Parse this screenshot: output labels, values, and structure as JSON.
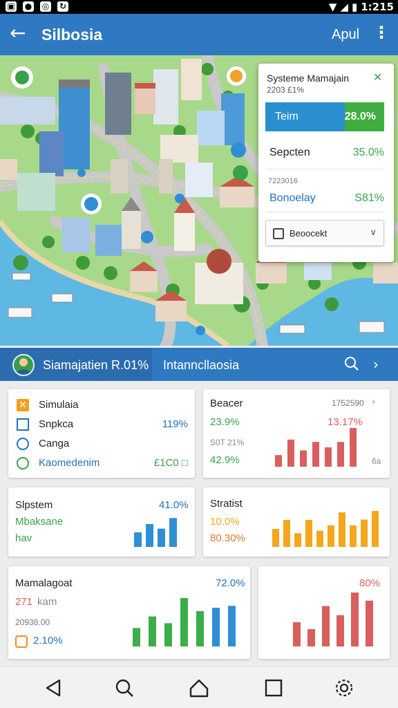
{
  "status_bar": {
    "time": "1:215"
  },
  "app_bar": {
    "title": "Silbosia",
    "right_label": "Apul"
  },
  "panel": {
    "title": "Systeme Mamajain",
    "subtitle": "2203 £1%",
    "progress": {
      "label": "Teim",
      "value": "28.0%",
      "fill_fraction": 0.33
    },
    "row1": {
      "label": "Sepcten",
      "value": "35.0%"
    },
    "row2": {
      "sublabel": "7223016",
      "label": "Bonoelay",
      "value": "S81%"
    },
    "dropdown": {
      "value": "Beoocekt"
    }
  },
  "sim_bar": {
    "title": "Siamajatien R.01%",
    "subtitle": "Intanncllaosia"
  },
  "card_legend": {
    "items": [
      {
        "label": "Simulaia",
        "value": "",
        "icon": "orange-x-icon",
        "color": "#f0a020"
      },
      {
        "label": "Snpkca",
        "value": "119%",
        "icon": "square-icon",
        "color": "#1e72b8"
      },
      {
        "label": "Canga",
        "value": "",
        "icon": "gauge-icon",
        "color": "#1e72b8"
      },
      {
        "label": "Kaomedenim",
        "value": "£1C0 □",
        "icon": "circle-icon",
        "color": "#3aa14a"
      }
    ]
  },
  "card_red": {
    "title": "Beacer",
    "corner": "1752590",
    "line1": "23.9%",
    "line1_right": "13.17%",
    "line2": "S0T 21%",
    "line3": "42.9%",
    "footnote": "6a",
    "bars": [
      0.3,
      0.7,
      0.42,
      0.64,
      0.5,
      0.64,
      1.0
    ]
  },
  "card_blue": {
    "title": "Slpstem",
    "line1": "Mbaksane",
    "line2": "hav",
    "value": "41.0%",
    "bars": [
      0.48,
      0.75,
      0.6,
      0.95
    ]
  },
  "card_orange": {
    "title": "Stratist",
    "line1": "10.0%",
    "line2": "80.30%",
    "bars": [
      0.5,
      0.75,
      0.38,
      0.75,
      0.45,
      0.6,
      0.96,
      0.6,
      0.76,
      1.0
    ]
  },
  "card_green": {
    "title": "Mamalagoat",
    "line1_num": "271",
    "line1_text": "kam",
    "line2": "20938.00",
    "line3": "2.10%",
    "value": "72.0%",
    "bars": [
      0.38,
      0.62,
      0.48,
      1.0,
      0.73,
      0.8,
      0.84
    ]
  },
  "card_red2": {
    "value": "80%",
    "bars": [
      0.45,
      0.32,
      0.75,
      0.58,
      1.0,
      0.85
    ]
  },
  "colors": {
    "app_blue": "#2f79c2",
    "green": "#3aa14a",
    "red": "#d95f5f",
    "orange": "#f4a61c",
    "bar_blue": "#2f8fd4"
  }
}
